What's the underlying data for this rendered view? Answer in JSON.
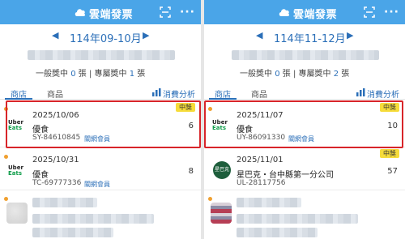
{
  "app": {
    "title": "雲端發票",
    "more": "···"
  },
  "panes": [
    {
      "id": "left",
      "period": "114年09-10月",
      "stats": {
        "general_prefix": "一般獎中",
        "general_count": "0",
        "general_unit": "張",
        "sep": "|",
        "special_prefix": "專屬獎中",
        "special_count": "1",
        "special_unit": "張"
      },
      "tabs": {
        "store": "商店",
        "product": "商品",
        "analysis": "消費分析"
      },
      "cards": [
        {
          "date": "2025/10/06",
          "merchant": "優食",
          "invoice_no": "SY-84610845",
          "member": "關網會員",
          "count": "6",
          "badge": "中獎",
          "logo": "uber-eats"
        },
        {
          "date": "2025/10/31",
          "merchant": "優食",
          "invoice_no": "TC-69777336",
          "member": "關網會員",
          "count": "8",
          "badge": "",
          "logo": "uber-eats"
        }
      ]
    },
    {
      "id": "right",
      "period": "114年11-12月",
      "stats": {
        "general_prefix": "一般獎中",
        "general_count": "0",
        "general_unit": "張",
        "sep": "|",
        "special_prefix": "專屬獎中",
        "special_count": "2",
        "special_unit": "張"
      },
      "tabs": {
        "store": "商店",
        "product": "商品",
        "analysis": "消費分析"
      },
      "cards": [
        {
          "date": "2025/11/07",
          "merchant": "優食",
          "invoice_no": "UY-86091330",
          "member": "關網會員",
          "count": "10",
          "badge": "中獎",
          "logo": "uber-eats"
        },
        {
          "date": "2025/11/01",
          "merchant": "星巴克・台中縣第一分公司",
          "invoice_no": "UL-28117756",
          "member": "",
          "count": "57",
          "badge": "中獎",
          "logo": "starbucks"
        }
      ]
    }
  ],
  "logos": {
    "uber_line1": "Uber",
    "uber_line2": "Eats",
    "starbucks": "星巴克"
  },
  "colors": {
    "topbar": "#4aa5e8",
    "accent": "#2b6fb8",
    "badge": "#f6dc3a",
    "highlight": "#d8252a",
    "dot": "#f0a030"
  }
}
